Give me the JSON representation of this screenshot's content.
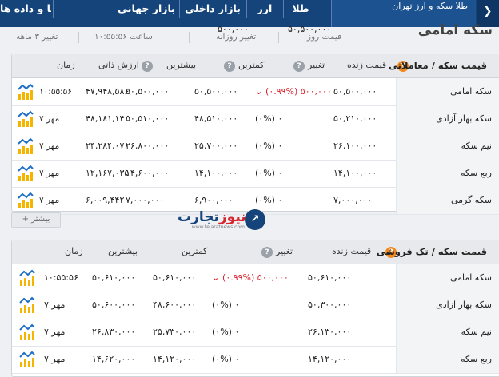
{
  "nav": {
    "tabs": [
      "نمودارها و داده ها",
      "بازار جهانی",
      "بازار داخلی",
      "ارز",
      "طلا"
    ],
    "brand_text": "طلا سکه و ارز تهران",
    "menu_icon": "chevron-icon"
  },
  "summary": {
    "price_value": "۵۰,۵۰۰,۰۰۰",
    "price_label": "قیمت روز",
    "change_value": "۵۰۰,۰۰۰",
    "change_label": "تغییر روزانه",
    "time_label": "ساعت ۱۰:۵۵:۵۶",
    "change3m_label": "تغییر ۳ ماهه"
  },
  "page_title": "سکه امامی",
  "panel1": {
    "title": "قیمت سکه / معاملاتی",
    "columns": [
      "قیمت زنده",
      "تغییر",
      "کمترین",
      "بیشترین",
      "ارزش ذاتی",
      "زمان"
    ],
    "rows": [
      {
        "name": "سکه امامی",
        "live": "۵۰,۵۰۰,۰۰۰",
        "change": "(۰.۹۹%) ۵۰۰,۰۰۰",
        "change_dir": "down",
        "low": "۵۰,۵۰۰,۰۰۰",
        "high": "۵۰,۵۰۰,۰۰۰",
        "intrinsic": "۴۷,۹۴۸,۵۸۶",
        "time": "۱۰:۵۵:۵۶"
      },
      {
        "name": "سکه بهار آزادی",
        "live": "۵۰,۲۱۰,۰۰۰",
        "change": "(۰%) ۰",
        "change_dir": "none",
        "low": "۴۸,۵۱۰,۰۰۰",
        "high": "۵۰,۵۱۰,۰۰۰",
        "intrinsic": "۴۸,۱۸۱,۱۴۰",
        "time": "۷ مهر"
      },
      {
        "name": "نیم سکه",
        "live": "۲۶,۱۰۰,۰۰۰",
        "change": "(۰%) ۰",
        "change_dir": "none",
        "low": "۲۵,۷۰۰,۰۰۰",
        "high": "۲۶,۸۰۰,۰۰۰",
        "intrinsic": "۲۴,۲۸۴,۰۷۰",
        "time": "۷ مهر"
      },
      {
        "name": "ربع سکه",
        "live": "۱۴,۱۰۰,۰۰۰",
        "change": "(۰%) ۰",
        "change_dir": "none",
        "low": "۱۴,۱۰۰,۰۰۰",
        "high": "۱۴,۶۰۰,۰۰۰",
        "intrinsic": "۱۲,۱۶۷,۰۳۵",
        "time": "۷ مهر"
      },
      {
        "name": "سکه گرمی",
        "live": "۷,۰۰۰,۰۰۰",
        "change": "(۰%) ۰",
        "change_dir": "none",
        "low": "۶,۹۰۰,۰۰۰",
        "high": "۷,۰۰۰,۰۰۰",
        "intrinsic": "۶,۰۰۹,۴۴۲",
        "time": "۷ مهر"
      }
    ],
    "more_label": "بیشتر"
  },
  "watermark": {
    "name_a": "تجارت",
    "name_b": "نیوز",
    "url": "www.tejaratnews.com"
  },
  "panel2": {
    "title": "قیمت سکه / تک فروشی",
    "columns": [
      "قیمت زنده",
      "تغییر",
      "کمترین",
      "بیشترین",
      "زمان"
    ],
    "rows": [
      {
        "name": "سکه امامی",
        "live": "۵۰,۶۱۰,۰۰۰",
        "change": "(۰.۹۹%) ۵۰۰,۰۰۰",
        "change_dir": "down",
        "low": "۵۰,۶۱۰,۰۰۰",
        "high": "۵۰,۶۱۰,۰۰۰",
        "time": "۱۰:۵۵:۵۶"
      },
      {
        "name": "سکه بهار آزادی",
        "live": "۵۰,۳۰۰,۰۰۰",
        "change": "(۰%) ۰",
        "change_dir": "none",
        "low": "۴۸,۶۰۰,۰۰۰",
        "high": "۵۰,۶۰۰,۰۰۰",
        "time": "۷ مهر"
      },
      {
        "name": "نیم سکه",
        "live": "۲۶,۱۳۰,۰۰۰",
        "change": "(۰%) ۰",
        "change_dir": "none",
        "low": "۲۵,۷۳۰,۰۰۰",
        "high": "۲۶,۸۳۰,۰۰۰",
        "time": "۷ مهر"
      },
      {
        "name": "ربع سکه",
        "live": "۱۴,۱۲۰,۰۰۰",
        "change": "(۰%) ۰",
        "change_dir": "none",
        "low": "۱۴,۱۲۰,۰۰۰",
        "high": "۱۴,۶۲۰,۰۰۰",
        "time": "۷ مهر"
      }
    ]
  },
  "colors": {
    "nav_bg": "#14447a",
    "accent_orange": "#f08a1c",
    "negative_red": "#d9232d",
    "chart_icon_blue": "#1f6fc5",
    "chart_icon_gold": "#f4b400"
  }
}
